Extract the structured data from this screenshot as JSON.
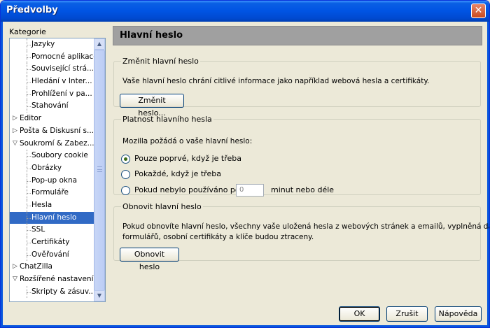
{
  "window": {
    "title": "Předvolby",
    "close_glyph": "✕"
  },
  "sidebar": {
    "label": "Kategorie",
    "items": [
      {
        "label": "Jazyky",
        "level": "child",
        "twisty": ""
      },
      {
        "label": "Pomocné aplikace",
        "level": "child",
        "twisty": ""
      },
      {
        "label": "Související strá...",
        "level": "child",
        "twisty": ""
      },
      {
        "label": "Hledání v Inter...",
        "level": "child",
        "twisty": ""
      },
      {
        "label": "Prohlížení v pa...",
        "level": "child",
        "twisty": ""
      },
      {
        "label": "Stahování",
        "level": "child",
        "twisty": ""
      },
      {
        "label": "Editor",
        "level": "parent",
        "twisty": "▷"
      },
      {
        "label": "Pošta & Diskusní s...",
        "level": "parent",
        "twisty": "▷"
      },
      {
        "label": "Soukromí & Zabez...",
        "level": "parent",
        "twisty": "▽"
      },
      {
        "label": "Soubory cookie",
        "level": "child",
        "twisty": ""
      },
      {
        "label": "Obrázky",
        "level": "child",
        "twisty": ""
      },
      {
        "label": "Pop-up okna",
        "level": "child",
        "twisty": ""
      },
      {
        "label": "Formuláře",
        "level": "child",
        "twisty": ""
      },
      {
        "label": "Hesla",
        "level": "child",
        "twisty": ""
      },
      {
        "label": "Hlavní heslo",
        "level": "child",
        "twisty": "",
        "selected": true
      },
      {
        "label": "SSL",
        "level": "child",
        "twisty": ""
      },
      {
        "label": "Certifikáty",
        "level": "child",
        "twisty": ""
      },
      {
        "label": "Ověřování",
        "level": "child",
        "twisty": ""
      },
      {
        "label": "ChatZilla",
        "level": "parent",
        "twisty": "▷"
      },
      {
        "label": "Rozšířené nastavení",
        "level": "parent",
        "twisty": "▽"
      },
      {
        "label": "Skripty & zásuv...",
        "level": "child",
        "twisty": ""
      }
    ],
    "scroll_up_glyph": "▲",
    "scroll_down_glyph": "▼"
  },
  "main": {
    "header": "Hlavní heslo",
    "change_group": {
      "legend": "Změnit hlavní heslo",
      "description": "Vaše hlavní heslo chrání citlivé informace jako například webová hesla a certifikáty.",
      "button": "Změnit heslo..."
    },
    "validity_group": {
      "legend": "Platnost hlavního hesla",
      "prompt": "Mozilla požádá o vaše hlavní heslo:",
      "options": [
        {
          "label": "Pouze poprvé, když je třeba",
          "checked": true
        },
        {
          "label": "Pokaždé, když je třeba",
          "checked": false
        },
        {
          "label": "Pokud nebylo používáno po",
          "checked": false
        }
      ],
      "minutes_value": "0",
      "minutes_suffix": "minut nebo déle"
    },
    "reset_group": {
      "legend": "Obnovit hlavní heslo",
      "description_line1": "Pokud obnovíte hlavní heslo, všechny vaše uložená hesla z webových stránek a emailů, vyplněná data z",
      "description_line2": "formulářů, osobní certifikáty a klíče budou ztraceny.",
      "button": "Obnovit heslo"
    }
  },
  "footer": {
    "ok": "OK",
    "cancel": "Zrušit",
    "help": "Nápověda"
  }
}
